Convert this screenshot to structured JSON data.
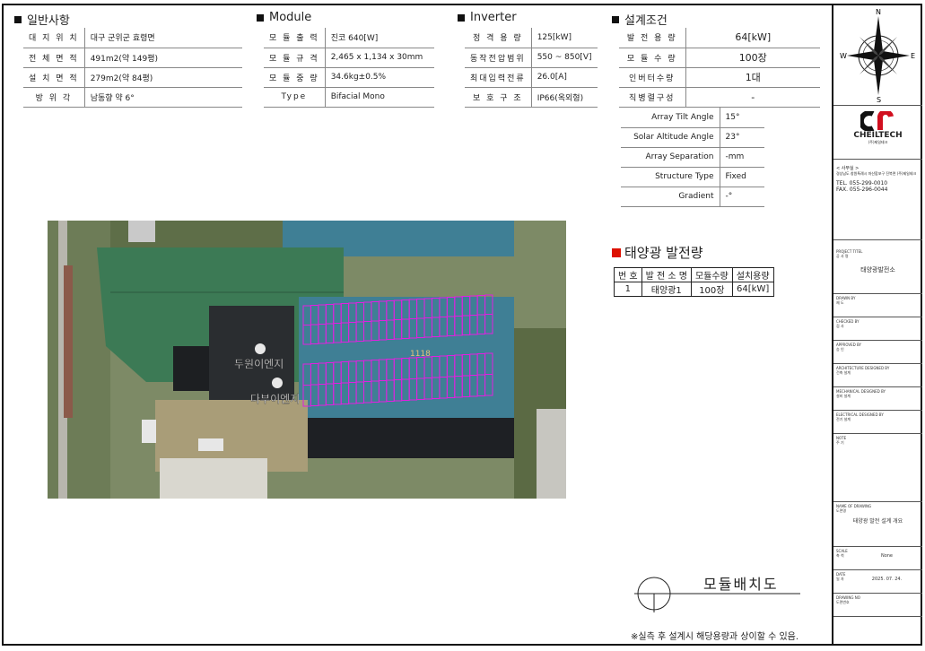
{
  "general": {
    "title": "일반사항",
    "rows": [
      {
        "k": "대 지 위 치",
        "v": "대구 군위군 효령면"
      },
      {
        "k": "전 체 면 적",
        "v": "491m2(약 149평)"
      },
      {
        "k": "설 치 면 적",
        "v": "279m2(약 84평)"
      },
      {
        "k": "방 위 각",
        "v": "남동향 약 6°"
      }
    ]
  },
  "module": {
    "title": "Module",
    "rows": [
      {
        "k": "모 듈 출 력",
        "v": "진코 640[W]"
      },
      {
        "k": "모 듈 규 격",
        "v": "2,465 x 1,134 x 30mm"
      },
      {
        "k": "모 듈 중 량",
        "v": "34.6kg±0.5%"
      },
      {
        "k": "Type",
        "v": "Bifacial Mono"
      }
    ]
  },
  "inverter": {
    "title": "Inverter",
    "rows": [
      {
        "k": "정 격 용 량",
        "v": "125[kW]"
      },
      {
        "k": "동작전압범위",
        "v": "550 ~ 850[V]"
      },
      {
        "k": "최대입력전류",
        "v": "26.0[A]"
      },
      {
        "k": "보 호 구 조",
        "v": "IP66(옥외형)"
      }
    ]
  },
  "design": {
    "title": "설계조건",
    "rows": [
      {
        "k": "발 전 용 량",
        "v": "64[kW]"
      },
      {
        "k": "모 듈 수 량",
        "v": "100장"
      },
      {
        "k": "인버터수량",
        "v": "1대"
      },
      {
        "k": "직병렬구성",
        "v": "-"
      }
    ],
    "rows2": [
      {
        "k": "Array Tilt Angle",
        "v": "15°"
      },
      {
        "k": "Solar Altitude Angle",
        "v": "23°"
      },
      {
        "k": "Array Separation",
        "v": "-mm"
      },
      {
        "k": "Structure Type",
        "v": "Fixed"
      },
      {
        "k": "Gradient",
        "v": "-°"
      }
    ]
  },
  "aerial": {
    "label_building": "1118",
    "label_place1": "두원이엔지",
    "label_place2": "다부이엔지"
  },
  "station": {
    "title": "태양광 발전량",
    "headers": [
      "번 호",
      "발 전 소 명",
      "모듈수량",
      "설치용량"
    ],
    "rows": [
      [
        "1",
        "태양광1",
        "100장",
        "64[kW]"
      ]
    ]
  },
  "drawing_title": "모듈배치도",
  "note": "※실측 후 설계시 해당용량과 상이할 수 있음.",
  "title_block": {
    "compass": {
      "n": "N",
      "s": "S",
      "e": "E",
      "w": "W"
    },
    "logo_text": "CHEILTECH",
    "logo_sub": "(주)제일테크",
    "office_label": "< 사무실 >",
    "office_addr": "경상남도 창원특례시 마산합포구 진북면 (주)제일테크",
    "tel": "TEL. 055-299-0010",
    "fax": "FAX. 055-296-0044",
    "project_label": "PROJECT TITEL",
    "project_label_ko": "공 사 명",
    "project_value": "태양광발전소",
    "drawn_label": "DRAWN BY",
    "drawn_label_ko": "제 도",
    "checked_label": "CHECKED BY",
    "checked_label_ko": "검 사",
    "approved_label": "APPROVED BY",
    "approved_label_ko": "승 인",
    "arch_label": "ARCHITECTURE DESIGNED BY",
    "arch_label_ko": "건축 설계",
    "mech_label": "MECHANICAL DESIGNED BY",
    "mech_label_ko": "설비 설계",
    "elec_label": "ELECTRICAL DESIGNED BY",
    "elec_label_ko": "전기 설계",
    "note_label": "NOTE",
    "note_label_ko": "주 기",
    "name_label": "NAME OF DRAWING",
    "name_label_ko": "도면명",
    "name_value": "태양광 발전 설계 개요",
    "scale_label": "SCALE",
    "scale_label_ko": "축 척",
    "scale_value": "None",
    "date_label": "DATE",
    "date_label_ko": "일 자",
    "date_value": "2025. 07. 24.",
    "drawing_no_label": "DRAWING NO",
    "drawing_no_label_ko": "도면번호"
  },
  "colors": {
    "panel_outline": "#e020e0",
    "roof_green": "#3c7a55",
    "roof_blue": "#3f7f95",
    "logo_red": "#d10f1f"
  }
}
